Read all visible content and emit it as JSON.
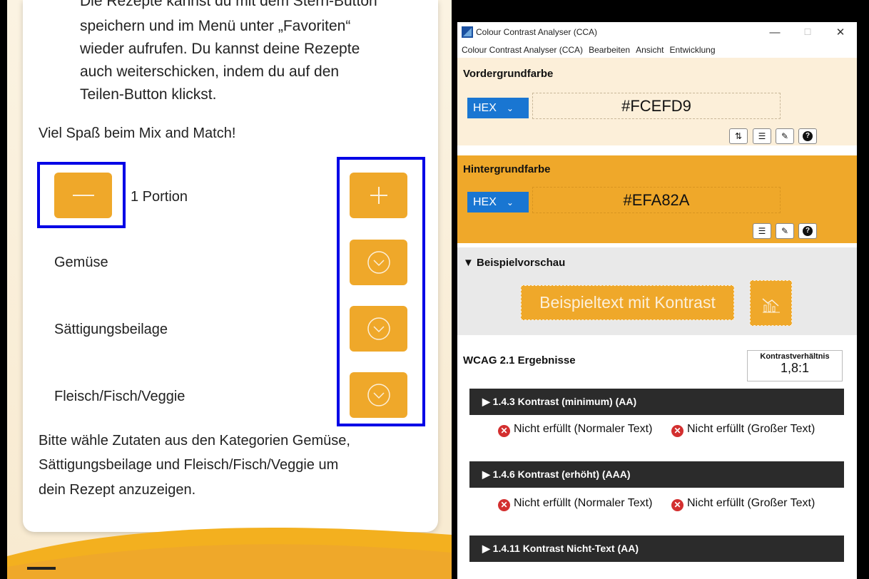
{
  "left_app": {
    "intro_lines": [
      "Die Rezepte kannst du mit dem Stern-Button",
      "speichern und im Menü unter „Favoriten“",
      "wieder aufrufen. Du kannst deine Rezepte",
      "auch weiterschicken, indem du auf den",
      "Teilen-Button klickst."
    ],
    "fun_line": "Viel Spaß beim Mix and Match!",
    "portion_label": "1 Portion",
    "categories": [
      "Gemüse",
      "Sättigungsbeilage",
      "Fleisch/Fisch/Veggie"
    ],
    "hint_lines": [
      "Bitte wähle Zutaten aus den Kategorien Gemüse,",
      "Sättigungsbeilage und Fleisch/Fisch/Veggie um",
      "dein Rezept anzuzeigen."
    ],
    "accent_color": "#efa82a",
    "highlight_color": "#0000e6"
  },
  "cca": {
    "window_title": "Colour Contrast Analyser (CCA)",
    "window_controls": {
      "minimize": "—",
      "maximize": "☐",
      "close": "✕"
    },
    "menu": [
      "Colour Contrast Analyser (CCA)",
      "Bearbeiten",
      "Ansicht",
      "Entwicklung"
    ],
    "foreground": {
      "title": "Vordergrundfarbe",
      "format": "HEX",
      "value": "#FCEFD9",
      "color": "#fcefd9"
    },
    "background": {
      "title": "Hintergrundfarbe",
      "format": "HEX",
      "value": "#EFA82A",
      "color": "#efa82a"
    },
    "preview": {
      "title": "▼ Beispielvorschau",
      "sample_text": "Beispieltext mit Kontrast"
    },
    "wcag": {
      "title": "WCAG 2.1 Ergebnisse",
      "ratio_label": "Kontrastverhältnis",
      "ratio_value": "1,8:1",
      "criteria": [
        {
          "label": "▶ 1.4.3 Kontrast (minimum) (AA)",
          "normal": "Nicht erfüllt (Normaler Text)",
          "large": "Nicht erfüllt (Großer Text)"
        },
        {
          "label": "▶ 1.4.6 Kontrast (erhöht) (AAA)",
          "normal": "Nicht erfüllt (Normaler Text)",
          "large": "Nicht erfüllt (Großer Text)"
        },
        {
          "label": "▶ 1.4.11 Kontrast Nicht-Text (AA)"
        }
      ]
    }
  }
}
